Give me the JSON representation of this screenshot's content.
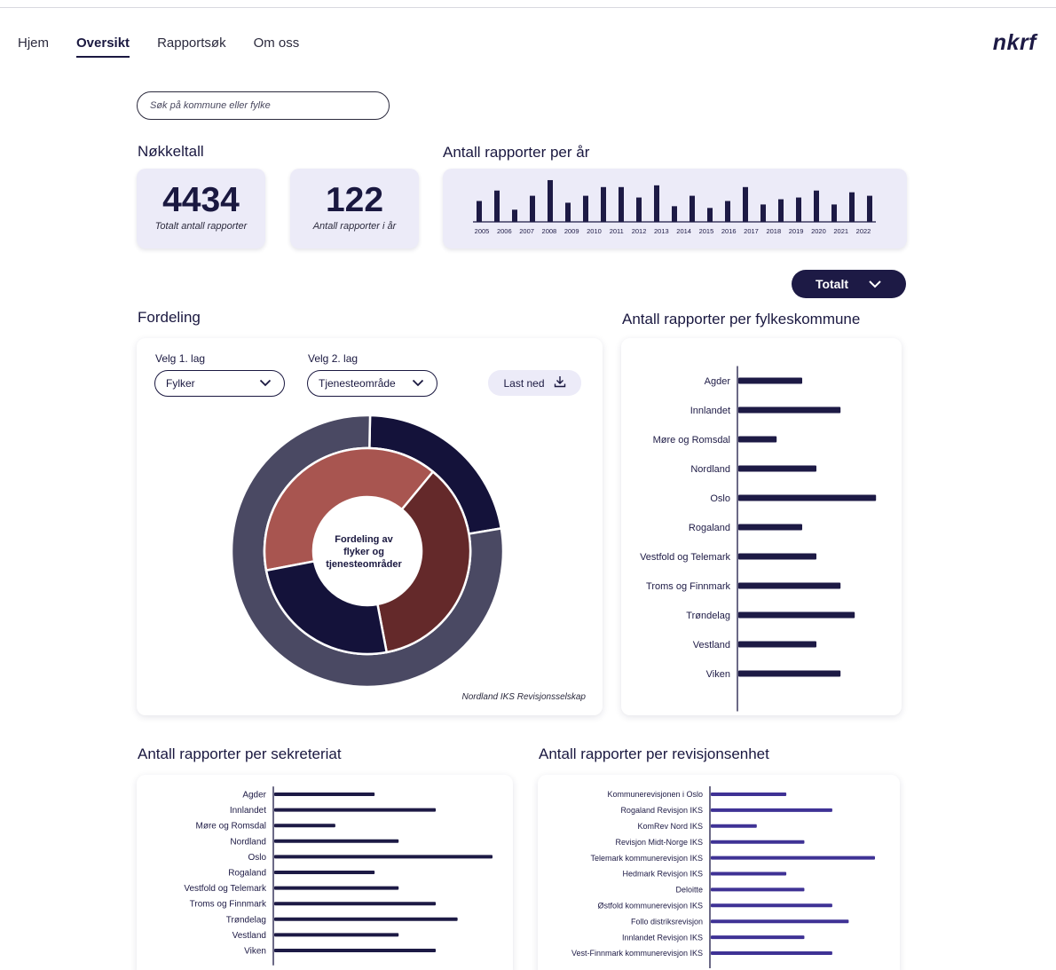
{
  "nav": {
    "items": [
      {
        "label": "Hjem",
        "active": false
      },
      {
        "label": "Oversikt",
        "active": true
      },
      {
        "label": "Rapportsøk",
        "active": false
      },
      {
        "label": "Om oss",
        "active": false
      }
    ],
    "logo": "nkrf"
  },
  "search": {
    "placeholder": "Søk på kommune eller fylke"
  },
  "nokkeltall": {
    "title": "Nøkkeltall",
    "total_value": "4434",
    "total_label": "Totalt antall rapporter",
    "year_value": "122",
    "year_label": "Antall rapporter i år"
  },
  "filter": {
    "selected": "Totalt",
    "icon": "chevron-down-icon"
  },
  "fordeling": {
    "title": "Fordeling",
    "layer1_label": "Velg 1. lag",
    "layer1_value": "Fylker",
    "layer2_label": "Velg 2. lag",
    "layer2_value": "Tjenesteområde",
    "download_label": "Last ned",
    "center_label_line1": "Fordeling av",
    "center_label_line2": "flyker og",
    "center_label_line3": "tjenesteområder",
    "source": "Nordland IKS Revisjonsselskap"
  },
  "colors": {
    "primary": "#1d1a45",
    "panel_bg": "#ecebf8",
    "outer_dark": "#14123a",
    "outer_slate": "#4a4963",
    "inner_red": "#a85550",
    "inner_brown": "#64292a",
    "inner_navy": "#14123a",
    "bar_navy": "#1d1a45",
    "bar_purple": "#3f3295"
  },
  "chart_data": [
    {
      "type": "bar",
      "title": "Antall rapporter per år",
      "categories": [
        "2005",
        "2006",
        "2007",
        "2008",
        "2009",
        "2010",
        "2011",
        "2012",
        "2013",
        "2014",
        "2015",
        "2016",
        "2017",
        "2018",
        "2019",
        "2020",
        "2021",
        "2022"
      ],
      "values": [
        24,
        36,
        14,
        30,
        48,
        22,
        30,
        40,
        40,
        28,
        42,
        18,
        30,
        16,
        24,
        40,
        20,
        26,
        28,
        36,
        20,
        34,
        30
      ],
      "ylim": [
        0,
        50
      ]
    },
    {
      "type": "bar",
      "orientation": "horizontal",
      "title": "Antall rapporter per fylkeskommune",
      "categories": [
        "Agder",
        "Innlandet",
        "Møre og Romsdal",
        "Nordland",
        "Oslo",
        "Rogaland",
        "Vestfold og Telemark",
        "Troms og Finnmark",
        "Trøndelag",
        "Vestland",
        "Viken"
      ],
      "values": [
        45,
        72,
        27,
        55,
        97,
        45,
        55,
        72,
        82,
        55,
        72
      ],
      "xlim": [
        0,
        100
      ]
    },
    {
      "type": "bar",
      "orientation": "horizontal",
      "title": "Antall rapporter per sekreteriat",
      "categories": [
        "Agder",
        "Innlandet",
        "Møre og Romsdal",
        "Nordland",
        "Oslo",
        "Rogaland",
        "Vestfold og Telemark",
        "Troms og Finnmark",
        "Trøndelag",
        "Vestland",
        "Viken"
      ],
      "values": [
        46,
        74,
        28,
        57,
        100,
        46,
        57,
        74,
        84,
        57,
        74
      ],
      "xlim": [
        0,
        100
      ]
    },
    {
      "type": "bar",
      "orientation": "horizontal",
      "title": "Antall rapporter per revisjonsenhet",
      "categories": [
        "Kommunerevisjonen i Oslo",
        "Rogaland Revisjon IKS",
        "KomRev Nord IKS",
        "Revisjon Midt-Norge IKS",
        "Telemark kommunerevisjon IKS",
        "Hedmark Revisjon IKS",
        "Deloitte",
        "Østfold kommunerevisjon IKS",
        "Follo distriksrevisjon",
        "Innlandet Revisjon IKS",
        "Vest-Finnmark kommunerevisjon IKS"
      ],
      "values": [
        46,
        74,
        28,
        57,
        100,
        46,
        57,
        74,
        84,
        57,
        74
      ],
      "xlim": [
        0,
        100
      ]
    },
    {
      "type": "pie",
      "title": "Fordeling",
      "rings": [
        {
          "name": "outer",
          "values": [
            22,
            78
          ]
        },
        {
          "name": "inner",
          "values": [
            39,
            36,
            25
          ]
        }
      ]
    }
  ]
}
